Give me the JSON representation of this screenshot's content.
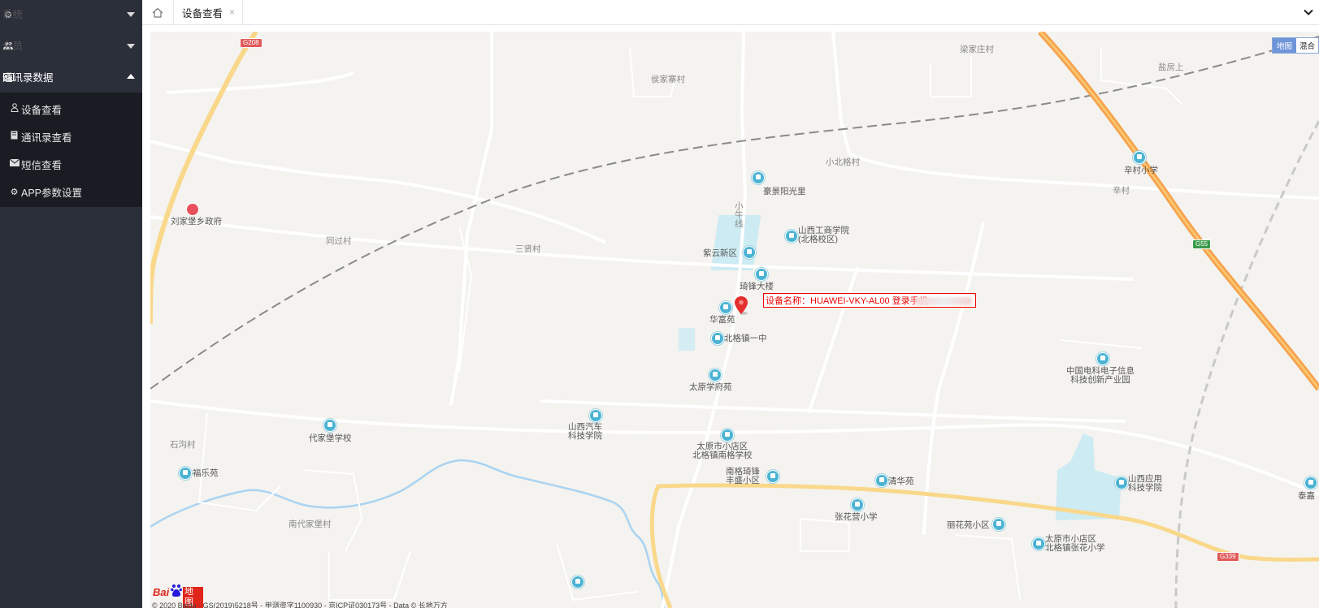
{
  "sidebar": {
    "menus": [
      {
        "label": "系统",
        "icon": "gear-icon",
        "expanded": false
      },
      {
        "label": "会员",
        "icon": "users-icon",
        "expanded": false
      },
      {
        "label": "通讯录数据",
        "icon": "id-card-icon",
        "expanded": true
      }
    ],
    "submenu": [
      {
        "label": "设备查看",
        "icon": "user-outline-icon"
      },
      {
        "label": "通讯录查看",
        "icon": "book-icon"
      },
      {
        "label": "短信查看",
        "icon": "envelope-icon"
      },
      {
        "label": "APP参数设置",
        "icon": "gear-icon"
      }
    ]
  },
  "tabs": {
    "home_icon": "home-icon",
    "active_label": "设备查看",
    "close_glyph": "×",
    "menu_icon": "chevron-down-icon"
  },
  "map": {
    "type_buttons": {
      "map": "地图",
      "hybrid": "混合"
    },
    "info_text": "设备名称：HUAWEI-VKY-AL00 登录手机:",
    "copyright": "© 2020 Baidu - GS(2019)5218号 - 甲测资字1100930 - 京ICP证030173号 - Data © 长地万方",
    "logo_text": {
      "left": "Bai",
      "right": "地图"
    },
    "road_badges": [
      "G208",
      "G55",
      "G339"
    ],
    "villages": [
      "梁家庄村",
      "侯家寨村",
      "盐房上",
      "小北格村",
      "辛村",
      "同过村",
      "三贤村",
      "石沟村",
      "南代家堡村"
    ],
    "pois": [
      {
        "name": "豪景阳光里"
      },
      {
        "name": "辛村小学"
      },
      {
        "name": "刘家堡乡政府"
      },
      {
        "name": "山西工商学院",
        "sub": "(北格校区)"
      },
      {
        "name": "紫云新区"
      },
      {
        "name": "琦锋大楼"
      },
      {
        "name": "华富苑"
      },
      {
        "name": "北格镇一中"
      },
      {
        "name": "太原学府苑"
      },
      {
        "name": "中国电科电子信息",
        "sub": "科技创新产业园"
      },
      {
        "name": "山西汽车",
        "sub": "科技学院"
      },
      {
        "name": "代家堡学校"
      },
      {
        "name": "太原市小店区",
        "sub": "北格镇南格学校"
      },
      {
        "name": "福乐苑"
      },
      {
        "name": "南格琦锋",
        "sub": "丰盛小区"
      },
      {
        "name": "清华苑"
      },
      {
        "name": "山西应用",
        "sub": "科技学院"
      },
      {
        "name": "泰嘉"
      },
      {
        "name": "张花营小学"
      },
      {
        "name": "丽花苑小区"
      },
      {
        "name": "太原市小店区",
        "sub": "北格镇张花小学"
      }
    ],
    "road_label_vertical": [
      "小",
      "牛",
      "线"
    ]
  }
}
